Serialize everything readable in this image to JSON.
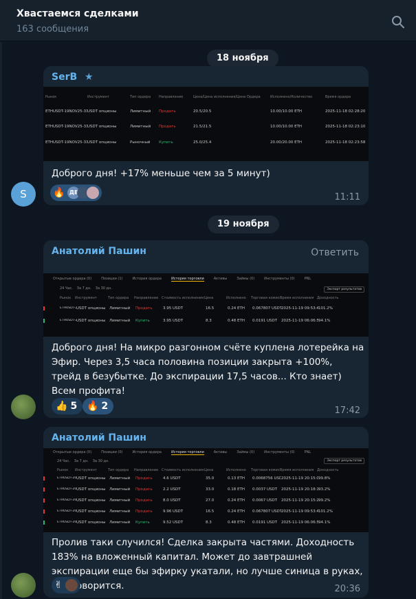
{
  "header": {
    "title": "Хвастаемся сделками",
    "subtitle": "163 сообщения",
    "search_icon": "search-icon"
  },
  "dates": [
    "18 ноября",
    "19 ноября"
  ],
  "messages": [
    {
      "sender": "SerB",
      "text": "Доброго дня! +17% меньше чем за 5 минут)",
      "time": "11:11",
      "avatar_letter": "S",
      "avatar_color": "#5aa1d8",
      "reactions": [
        {
          "emoji": "🔥",
          "count": ""
        },
        {
          "emoji": "",
          "count": "ДВ"
        }
      ],
      "table": {
        "headers": [
          "Рынок",
          "Инструмент",
          "Тип ордера",
          "Направление",
          "Цена/Цена исполнения/Цена Ордера",
          "Исполнено/Количество",
          "Время ордера"
        ],
        "rows": [
          [
            "ETHUSDT-19NOV25-3100-C",
            "USDT опционы",
            "Лимитный",
            "Продать",
            "20.5/20.5",
            "10.00/10.00 ETH",
            "2025-11-18 02:28:20"
          ],
          [
            "ETHUSDT-19NOV25-3100-C",
            "USDT опционы",
            "Лимитный",
            "Продать",
            "21.5/21.5",
            "10.00/10.00 ETH",
            "2025-11-18 02:23:10"
          ],
          [
            "ETHUSDT-19NOV25-3100-C",
            "USDT опционы",
            "Рыночный",
            "Купить",
            "25.0/25.4",
            "20.00/20.00 ETH",
            "2025-11-18 02:23:58"
          ]
        ]
      }
    },
    {
      "sender": "Анатолий Пашин",
      "reply_label": "Ответить",
      "text": "Доброго дня! На микро разгонном счёте куплена лотерейка на Эфир. Через 3,5 часа половина позиции закрыта +100%, трейд в безубытке. До экспирации 17,5 часов... Кто знает)\nВсем профита!",
      "time": "17:42",
      "reactions": [
        {
          "emoji": "👍",
          "count": "5"
        },
        {
          "emoji": "🔥",
          "count": "2"
        }
      ],
      "table": {
        "tabs": [
          "Открытые ордера (0)",
          "Позиции (1)",
          "История ордера",
          "История торговли",
          "Активы",
          "Займы (0)",
          "Инструменты (0)",
          "PNL"
        ],
        "filters": [
          "24 Час.",
          "За 7 дн.",
          "За 30 дн."
        ],
        "export_label": "Экспорт результатов",
        "headers": [
          "Рынок",
          "Инструмент",
          "Тип ордера",
          "Направление",
          "Стоимость исполнения",
          "Цена",
          "Исполнено",
          "Торговая комиссия",
          "Время исполнения",
          "Доходность"
        ],
        "rows": [
          [
            "ETHUSDT-20NOV25-3300-P",
            "USDT опционы",
            "Лимитный",
            "Продать",
            "3.95 USDT",
            "16.5",
            "0.24 ETH",
            "0.067807 USDT",
            "2025-11-19 09:53:41",
            "101.2%"
          ],
          [
            "ETHUSDT-20NOV25-3300-P",
            "USDT опционы",
            "Лимитный",
            "Купить",
            "3.95 USDT",
            "8.3",
            "0.48 ETH",
            "0.0191 USDT",
            "2025-11-19 06:06:57",
            "94.1%"
          ]
        ]
      }
    },
    {
      "sender": "Анатолий Пашин",
      "text": "Пролив таки случился! Сделка закрыта частями. Доходность 183% на вложенный капитал. Может до завтрашней экспирации еще бы эфирку укатали, но лучше синица в руках, как говорится.",
      "time": "20:36",
      "reactions": [
        {
          "emoji": "✌",
          "count": ""
        }
      ],
      "table": {
        "tabs": [
          "Открытые ордера (0)",
          "Позиции (0)",
          "История ордера",
          "История торговли",
          "Активы",
          "Займы (0)",
          "Инструменты (0)",
          "PNL"
        ],
        "filters": [
          "24 Час.",
          "За 7 дн.",
          "За 30 дн."
        ],
        "export_label": "Экспорт результатов",
        "headers": [
          "Рынок",
          "Инструмент",
          "Тип ордера",
          "Направление",
          "Стоимость исполнения",
          "Цена",
          "Исполнено",
          "Торговая комиссия",
          "Время исполнения",
          "Доходность"
        ],
        "rows": [
          [
            "ETHUSDT-20NOV25-2915-P",
            "USDT опционы",
            "Лимитный",
            "Продать",
            "4.6 USDT",
            "35.0",
            "0.13 ETH",
            "0.0068756 USDT",
            "2025-11-19 20:15:02",
            "99.8%"
          ],
          [
            "ETHUSDT-20NOV25-2915-P",
            "USDT опционы",
            "Лимитный",
            "Продать",
            "2.2 USDT",
            "33.0",
            "0.18 ETH",
            "0.0037 USDT",
            "2025-11-19 20:18:10",
            "93.2%"
          ],
          [
            "ETHUSDT-20NOV25-2915-P",
            "USDT опционы",
            "Лимитный",
            "Продать",
            "8.0 USDT",
            "27.0",
            "0.24 ETH",
            "0.0067 USDT",
            "2025-11-19 20:15:28",
            "99.2%"
          ],
          [
            "ETHUSDT-20NOV25-2915-P",
            "USDT опционы",
            "Лимитный",
            "Продать",
            "9.96 USDT",
            "16.5",
            "0.24 ETH",
            "0.067807 USDT",
            "2025-11-19 09:53:41",
            "101.2%"
          ],
          [
            "ETHUSDT-20NOV25-2915-P",
            "USDT опционы",
            "Лимитный",
            "Купить",
            "9.52 USDT",
            "8.3",
            "0.48 ETH",
            "0.0191 USDT",
            "2025-11-19 06:06:57",
            "94.1%"
          ]
        ]
      }
    }
  ]
}
